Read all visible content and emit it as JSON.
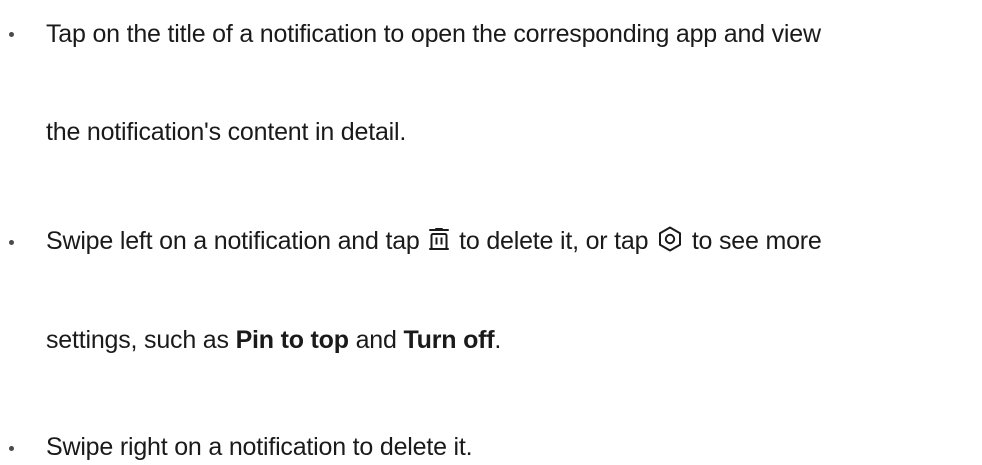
{
  "items": [
    {
      "line1": "Tap on the title of a notification to open the corresponding app and view",
      "line2": "the notification's content in detail."
    },
    {
      "line1_a": "Swipe left on a notification and tap",
      "line1_b": "to delete it, or tap",
      "line1_c": "to see more",
      "line2_a": "settings, such as",
      "line2_b": "Pin to top",
      "line2_c": "and",
      "line2_d": "Turn off",
      "line2_e": ".",
      "icons": [
        "trash-icon",
        "settings-hexagon-icon"
      ]
    },
    {
      "line1": "Swipe right on a notification to delete it."
    }
  ]
}
